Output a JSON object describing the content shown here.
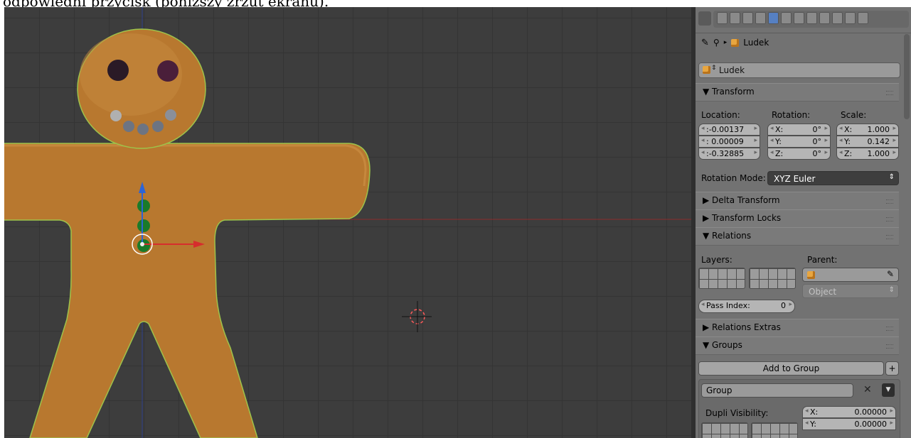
{
  "caption": "odpowiedni przycisk (poniższy zrzut ekranu).",
  "colors": {
    "viewport_bg": "#3d3d3d",
    "panel_bg": "#727272",
    "gingerbread": "#b8782f",
    "outline": "#9dc34b",
    "axis_x": "#d62d2d",
    "axis_y": "#2d64d6"
  },
  "props": {
    "breadcrumb": {
      "object": "Ludek"
    },
    "name_field": "Ludek",
    "transform": {
      "header": "Transform",
      "location_label": "Location:",
      "rotation_label": "Rotation:",
      "scale_label": "Scale:",
      "location": [
        ":-0.00137",
        ": 0.00009",
        ":-0.32885"
      ],
      "rotation_keys": [
        "X:",
        "Y:",
        "Z:"
      ],
      "rotation": [
        "0°",
        "0°",
        "0°"
      ],
      "scale_keys": [
        "X:",
        "Y:",
        "Z:"
      ],
      "scale": [
        "1.000",
        "0.142",
        "1.000"
      ],
      "rotation_mode_label": "Rotation Mode:",
      "rotation_mode": "XYZ Euler"
    },
    "delta_transform": "Delta Transform",
    "transform_locks": "Transform Locks",
    "relations": {
      "header": "Relations",
      "layers_label": "Layers:",
      "parent_label": "Parent:",
      "parent_type": "Object",
      "pass_index_label": "Pass Index:",
      "pass_index": "0"
    },
    "relations_extras": "Relations Extras",
    "groups": {
      "header": "Groups",
      "add_to_group": "Add to Group",
      "group_name": "Group",
      "dupli_visibility_label": "Dupli Visibility:",
      "dupli_keys": [
        "X:",
        "Y:"
      ],
      "dupli": [
        "0.00000",
        "0.00000"
      ]
    }
  }
}
